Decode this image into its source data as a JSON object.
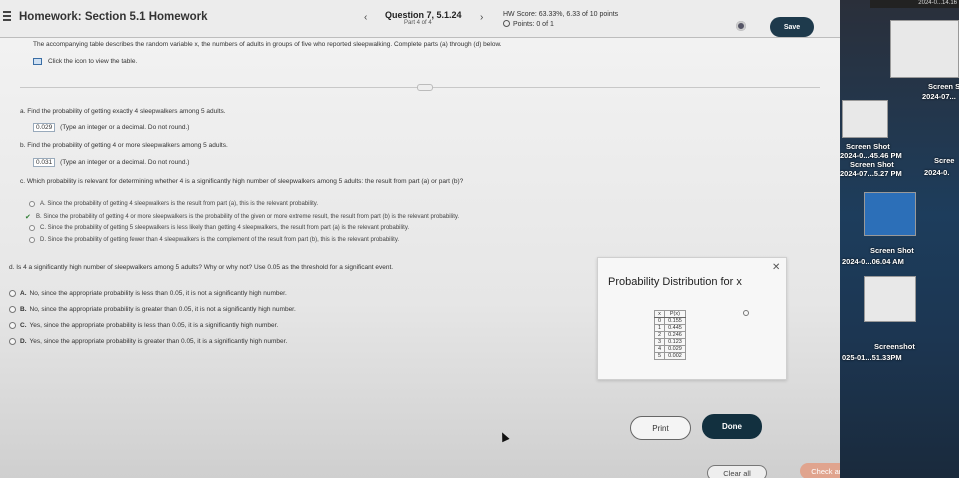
{
  "header": {
    "title": "Homework: Section 5.1 Homework",
    "question": "Question 7, 5.1.24",
    "part": "Part 4 of 4",
    "hw_score": "HW Score: 63.33%, 6.33 of 10 points",
    "points": "Points: 0 of 1",
    "save_label": "Save",
    "prev_glyph": "‹",
    "next_glyph": "›"
  },
  "intro": {
    "text": "The accompanying table describes the random variable x, the numbers of adults in groups of five who reported sleepwalking. Complete parts (a) through (d) below.",
    "table_link": "Click the icon to view the table."
  },
  "part_a": {
    "question": "a. Find the probability of getting exactly 4 sleepwalkers among 5 adults.",
    "answer": "0.029",
    "hint": "(Type an integer or a decimal. Do not round.)"
  },
  "part_b": {
    "question": "b. Find the probability of getting 4 or more sleepwalkers among 5 adults.",
    "answer": "0.031",
    "hint": "(Type an integer or a decimal. Do not round.)"
  },
  "part_c": {
    "question": "c. Which probability is relevant for determining whether 4 is a significantly high number of sleepwalkers among 5 adults: the result from part (a) or part (b)?",
    "options": [
      "A.  Since the probability of getting 4 sleepwalkers is the result from part (a), this is the relevant probability.",
      "B.  Since the probability of getting 4 or more sleepwalkers is the probability of the given or more extreme result, the result from part (b) is the relevant probability.",
      "C.  Since the probability of getting 5 sleepwalkers is less likely than getting 4 sleepwalkers, the result from part (a) is the relevant probability.",
      "D.  Since the probability of getting fewer than 4 sleepwalkers is the complement of the result from part (b), this is the relevant probability."
    ],
    "check_glyph": "✔"
  },
  "part_d": {
    "question": "d. Is 4 a significantly high number of sleepwalkers among 5 adults? Why or why not? Use 0.05 as the threshold for a significant event.",
    "options": [
      {
        "letter": "A.",
        "text": "No, since the appropriate probability is less than 0.05, it is not a significantly high number."
      },
      {
        "letter": "B.",
        "text": "No, since the appropriate probability is greater than 0.05, it is not a significantly high number."
      },
      {
        "letter": "C.",
        "text": "Yes, since the appropriate probability is less than 0.05, it is a significantly high number."
      },
      {
        "letter": "D.",
        "text": "Yes, since the appropriate probability is greater than 0.05, it is a significantly high number."
      }
    ]
  },
  "dialog": {
    "title": "Probability Distribution for x",
    "close_glyph": "✕",
    "columns": [
      "x",
      "P(x)"
    ],
    "rows": [
      [
        "0",
        "0.155"
      ],
      [
        "1",
        "0.445"
      ],
      [
        "2",
        "0.246"
      ],
      [
        "3",
        "0.123"
      ],
      [
        "4",
        "0.029"
      ],
      [
        "5",
        "0.002"
      ]
    ],
    "print_label": "Print",
    "done_label": "Done"
  },
  "footer": {
    "clear_label": "Clear all",
    "check_label": "Check answer"
  },
  "desktop": {
    "clock": "2024-0...14.16",
    "labels": [
      "Screen S",
      "2024-07...",
      "Screen Shot",
      "2024-0...45.46 PM",
      "Screen Shot",
      "2024-07...5.27 PM",
      "Scree",
      "2024-0.",
      "Screen Shot",
      "2024-0...06.04 AM",
      "Screenshot",
      "025-01...51.33PM"
    ]
  }
}
